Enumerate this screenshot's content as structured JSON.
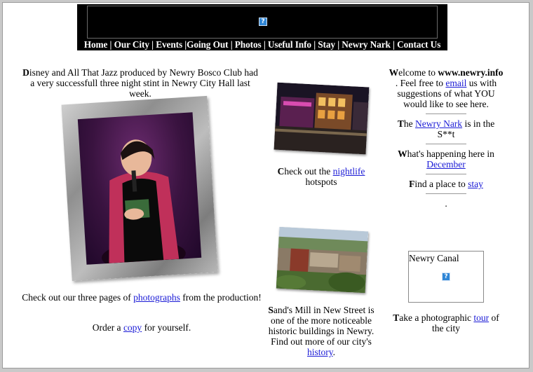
{
  "nav": {
    "items": [
      "Home",
      "Our City",
      "Events",
      "Going Out",
      "Photos",
      "Useful Info",
      "Stay",
      "Newry Nark",
      "Contact Us"
    ]
  },
  "left": {
    "intro_first": "D",
    "intro_rest": "isney and All That Jazz produced by Newry Bosco Club had a very successfull three night stint in Newry City Hall last week.",
    "photos_pre": "Check out our three pages of ",
    "photos_link": "photographs",
    "photos_post": " from the production!",
    "order_pre": "Order a ",
    "order_link": "copy",
    "order_post": " for yourself."
  },
  "middle": {
    "nightlife_first": "C",
    "nightlife_pre": "heck out the ",
    "nightlife_link": "nightlife",
    "nightlife_post": " hotspots",
    "sands_first": "S",
    "sands_pre": "and's Mill in New Street is one of the more noticeable historic buildings in Newry. Find out more of our city's ",
    "sands_link": "history",
    "sands_post": "."
  },
  "right": {
    "welcome_first": "W",
    "welcome_pre": "elcome to ",
    "welcome_site": "www.newry.info",
    "welcome_mid": ". Feel free to ",
    "welcome_link": "email",
    "welcome_post": " us with suggestions of what YOU would like to see here.",
    "nark_first": "T",
    "nark_pre": "he ",
    "nark_link": "Newry Nark",
    "nark_post": " is in the S**t",
    "happening_first": "W",
    "happening_pre": "hat's happening here in ",
    "happening_link": "December",
    "stay_first": "F",
    "stay_pre": "ind a place to ",
    "stay_link": "stay",
    "dot": ".",
    "canal_label": "Newry Canal",
    "tour_first": "T",
    "tour_pre": "ake a photographic ",
    "tour_link": "tour",
    "tour_post": " of the city"
  },
  "icons": {
    "broken_image": "?"
  }
}
